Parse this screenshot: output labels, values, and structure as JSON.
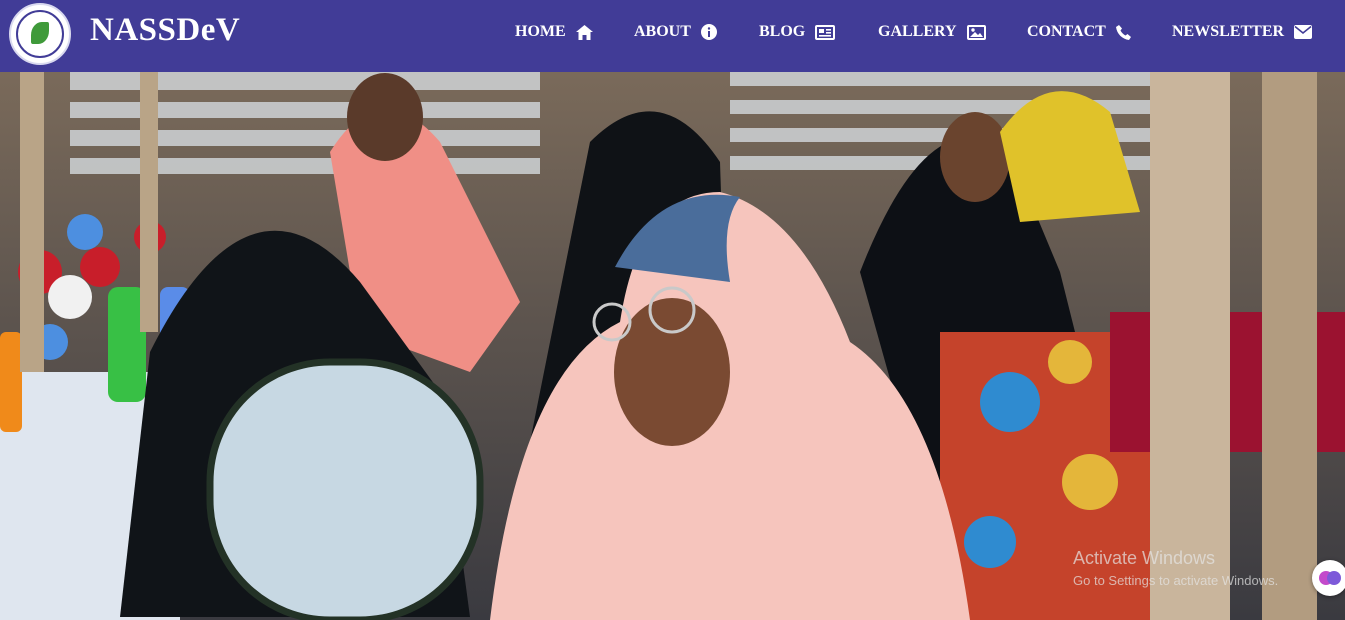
{
  "site": {
    "brand": "NASSDeV"
  },
  "nav": {
    "items": [
      {
        "label": "HOME",
        "icon": "home-icon"
      },
      {
        "label": "ABOUT",
        "icon": "info-icon"
      },
      {
        "label": "BLOG",
        "icon": "newspaper-icon"
      },
      {
        "label": "GALLERY",
        "icon": "image-icon"
      },
      {
        "label": "CONTACT",
        "icon": "phone-icon"
      },
      {
        "label": "NEWSLETTER",
        "icon": "envelope-icon"
      }
    ]
  },
  "watermark": {
    "line1": "Activate Windows",
    "line2": "Go to Settings to activate Windows."
  },
  "colors": {
    "nav_bg": "#413c97",
    "text": "#ffffff"
  }
}
